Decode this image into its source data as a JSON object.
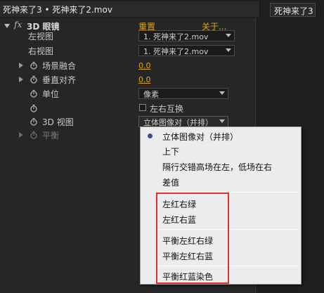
{
  "header": {
    "panel_title": "死神来了3 • 死神来了2.mov",
    "right_tab_title": "死神来了3"
  },
  "effect": {
    "fx_label": "fx",
    "name": "3D 眼镜",
    "reset_label": "重置",
    "about_label": "关于..."
  },
  "properties": {
    "left_view": {
      "label": "左视图",
      "value": "1. 死神来了2.mov"
    },
    "right_view": {
      "label": "右视图",
      "value": "1. 死神来了2.mov"
    },
    "scene_convergence": {
      "label": "场景融合",
      "value": "0.0"
    },
    "vertical_align": {
      "label": "垂直对齐",
      "value": "0.0"
    },
    "units": {
      "label": "单位",
      "value": "像素"
    },
    "swap": {
      "label": "左右互换"
    },
    "view_3d": {
      "label": "3D 视图",
      "value": "立体图像对（并排）"
    },
    "balance": {
      "label": "平衡"
    }
  },
  "menu": {
    "items": [
      {
        "label": "立体图像对（并排）",
        "selected": true
      },
      {
        "label": "上下"
      },
      {
        "label": "隔行交错高场在左，低场在右"
      },
      {
        "label": "差值"
      },
      {
        "label": "左红右绿"
      },
      {
        "label": "左红右蓝"
      },
      {
        "label": "平衡左红右绿"
      },
      {
        "label": "平衡左红右蓝"
      },
      {
        "label": "平衡红蓝染色"
      }
    ]
  },
  "colors": {
    "accent_orange": "#d9a420",
    "highlight_red": "#e0302e",
    "menu_bg": "#ececec",
    "panel_bg": "#262626"
  },
  "icons": {
    "twisty_expanded": "triangle-down-icon",
    "twisty_collapsed": "triangle-right-icon",
    "stopwatch": "stopwatch-icon",
    "dropdown": "chevron-down-icon",
    "radio": "radio-bullet-icon"
  }
}
